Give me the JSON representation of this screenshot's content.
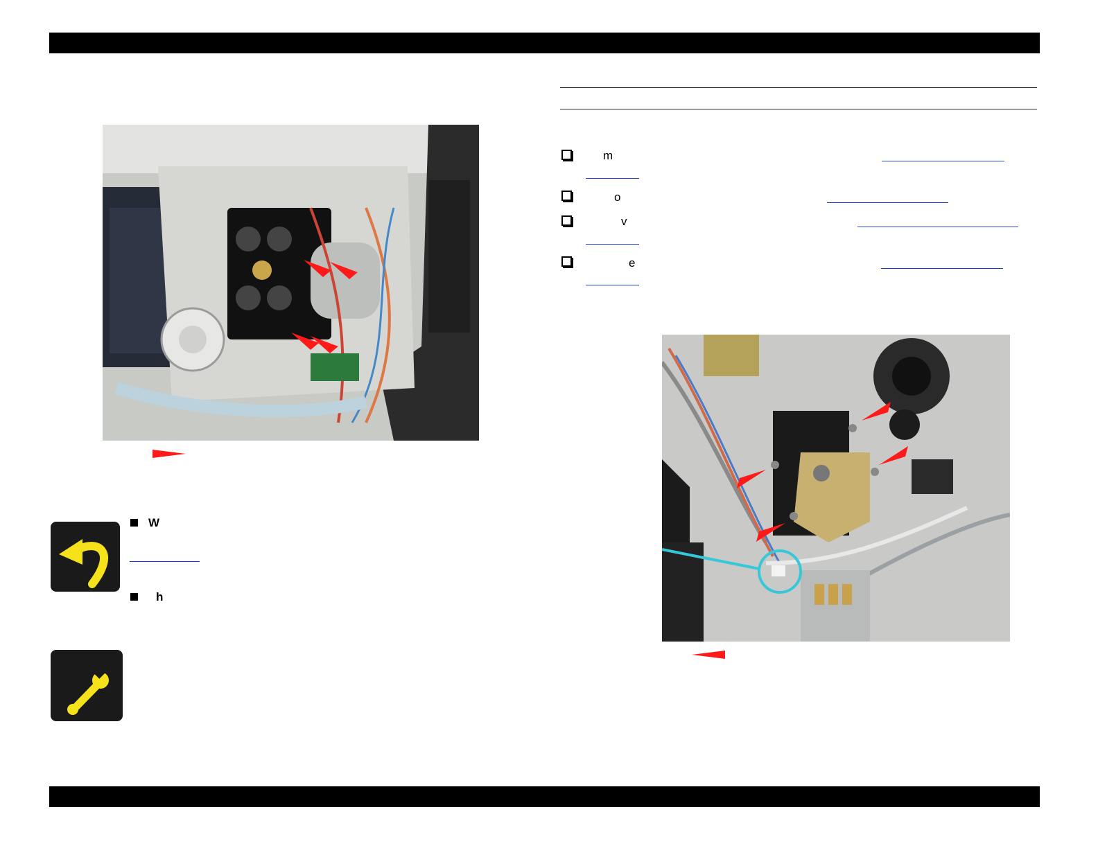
{
  "left_column": {
    "figure_caption_arrow": "red-arrow-marker",
    "bullets": [
      {
        "letter": "W"
      },
      {
        "letter": "h"
      }
    ],
    "icons": [
      "undo-arrow-icon",
      "wrench-icon"
    ]
  },
  "right_column": {
    "checklist": [
      {
        "letter": "m"
      },
      {
        "letter": "o"
      },
      {
        "letter": "v"
      },
      {
        "letter": "e"
      }
    ],
    "figure_caption_arrow": "red-arrow-marker"
  },
  "colors": {
    "bar": "#000000",
    "link": "#1d3fcf",
    "marker": "#ff1a1a",
    "icon_yellow": "#f5e21b",
    "highlight_circle": "#36c8d8"
  }
}
